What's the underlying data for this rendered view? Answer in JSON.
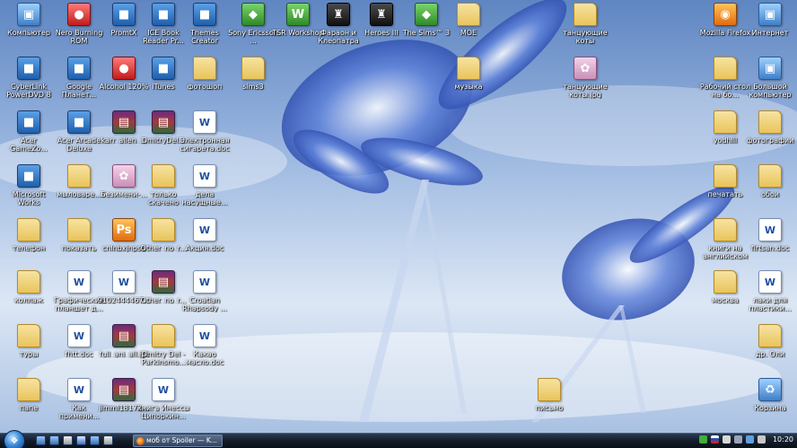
{
  "desktop": {
    "icons": [
      {
        "label": "Компьютер",
        "icon": "computer-icon"
      },
      {
        "label": "Nero Burning ROM",
        "icon": "nero-icon"
      },
      {
        "label": "PromtX",
        "icon": "promt-icon"
      },
      {
        "label": "ICE Book Reader Pr...",
        "icon": "book-reader-icon"
      },
      {
        "label": "Themes Creator",
        "icon": "themes-icon"
      },
      {
        "label": "Sony Ericsson ...",
        "icon": "sony-ericsson-icon"
      },
      {
        "label": "TSR Workshop",
        "icon": "tsr-workshop-icon"
      },
      {
        "label": "Фараон и Клеопатра",
        "icon": "pharaoh-game-icon"
      },
      {
        "label": "Heroes III",
        "icon": "heroes-game-icon"
      },
      {
        "label": "The Sims™ 3",
        "icon": "sims-game-icon"
      },
      {
        "label": "MOE",
        "icon": "folder-icon"
      },
      {
        "label": "танцующие коты",
        "icon": "folder-icon"
      },
      {
        "label": "Mozilla Firefox",
        "icon": "firefox-icon"
      },
      {
        "label": "Интернет",
        "icon": "internet-icon"
      },
      {
        "label": "CyberLink PowerDVD 8",
        "icon": "powerdvd-icon"
      },
      {
        "label": "Google Планет...",
        "icon": "google-earth-icon"
      },
      {
        "label": "Alcohol 120%",
        "icon": "alcohol-icon"
      },
      {
        "label": "iTunes",
        "icon": "itunes-icon"
      },
      {
        "label": "фотошоп",
        "icon": "folder-icon"
      },
      {
        "label": "sims3",
        "icon": "folder-icon"
      },
      {
        "label": "музыка",
        "icon": "folder-icon"
      },
      {
        "label": "танцующие коты.jpg",
        "icon": "image-file-icon"
      },
      {
        "label": "Рабочий стол на бо...",
        "icon": "folder-icon"
      },
      {
        "label": "Большой компьютер",
        "icon": "network-computer-icon"
      },
      {
        "label": "Acer GameZo...",
        "icon": "acer-gamezone-icon"
      },
      {
        "label": "Acer Arcade Deluxe",
        "icon": "acer-arcade-icon"
      },
      {
        "label": "karr_allen_...",
        "icon": "rar-archive-icon"
      },
      {
        "label": "DmitryDel...",
        "icon": "rar-archive-icon"
      },
      {
        "label": "Электронная сигарета.doc",
        "icon": "word-doc-icon"
      },
      {
        "label": "yodhill",
        "icon": "folder-icon"
      },
      {
        "label": "фотографии",
        "icon": "folder-icon"
      },
      {
        "label": "Microsoft Works",
        "icon": "ms-works-icon"
      },
      {
        "label": "мыловаре...",
        "icon": "folder-icon"
      },
      {
        "label": "Безимени-...",
        "icon": "image-file-icon"
      },
      {
        "label": "только скачено",
        "icon": "folder-icon"
      },
      {
        "label": "дела насущные...",
        "icon": "word-doc-icon"
      },
      {
        "label": "печатать",
        "icon": "folder-icon"
      },
      {
        "label": "обои",
        "icon": "folder-icon"
      },
      {
        "label": "телефон",
        "icon": "folder-icon"
      },
      {
        "label": "показать",
        "icon": "folder-icon"
      },
      {
        "label": "cnlnbxjnpsd",
        "icon": "psd-file-icon"
      },
      {
        "label": "Other_no_r...",
        "icon": "folder-icon"
      },
      {
        "label": "Акция.doc",
        "icon": "word-doc-icon"
      },
      {
        "label": "книги на английском",
        "icon": "folder-icon"
      },
      {
        "label": "firtsan.doc",
        "icon": "word-doc-icon"
      },
      {
        "label": "коллаж",
        "icon": "folder-icon"
      },
      {
        "label": "Графические планшет д...",
        "icon": "word-doc-icon"
      },
      {
        "label": "9102444467...",
        "icon": "word-doc-icon"
      },
      {
        "label": "Other_no_r...",
        "icon": "rar-archive-icon"
      },
      {
        "label": "Croatian Rhapsody ...",
        "icon": "word-doc-icon"
      },
      {
        "label": "москва",
        "icon": "folder-icon"
      },
      {
        "label": "лаки для пластики...",
        "icon": "word-doc-icon"
      },
      {
        "label": "туры",
        "icon": "folder-icon"
      },
      {
        "label": "fhtt.doc",
        "icon": "word-doc-icon"
      },
      {
        "label": "full_ani_all.jpt",
        "icon": "rar-archive-icon"
      },
      {
        "label": "Dmitry Del - Parkinsmo...",
        "icon": "folder-icon"
      },
      {
        "label": "Какао масло.doc",
        "icon": "word-doc-icon"
      },
      {
        "label": "др. Оли",
        "icon": "folder-icon"
      },
      {
        "label": "папе",
        "icon": "folder-icon"
      },
      {
        "label": "Как примени...",
        "icon": "word-doc-icon"
      },
      {
        "label": "jimmi18173...",
        "icon": "rar-archive-icon"
      },
      {
        "label": "книга Инессы Ципоркин...",
        "icon": "word-doc-icon"
      },
      {
        "label": "письмо",
        "icon": "folder-icon"
      },
      {
        "label": "Корзина",
        "icon": "recycle-bin-icon"
      }
    ]
  },
  "taskbar": {
    "start_label": "Start",
    "active_window": "моб от Spoiler — K...",
    "clock": "10:20"
  }
}
